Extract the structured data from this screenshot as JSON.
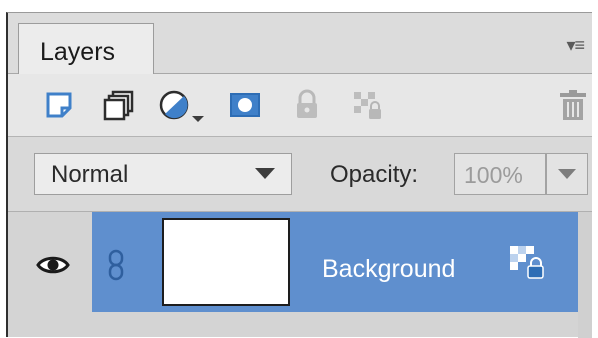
{
  "panel": {
    "tab_label": "Layers",
    "menu_icon": "panel-menu-icon"
  },
  "toolbar": {
    "tools": [
      {
        "icon": "new-layer-icon"
      },
      {
        "icon": "layer-group-icon"
      },
      {
        "icon": "adjustment-layer-icon"
      },
      {
        "icon": "layer-mask-icon"
      },
      {
        "icon": "lock-icon"
      },
      {
        "icon": "lock-transparency-icon"
      },
      {
        "icon": "trash-icon"
      }
    ]
  },
  "blend": {
    "mode": "Normal",
    "opacity_label": "Opacity:",
    "opacity_value": "100%"
  },
  "layers": [
    {
      "name": "Background",
      "visible": true,
      "selected": true,
      "locked": true
    }
  ],
  "colors": {
    "accent": "#5f8fce",
    "icon_blue": "#3f80c9"
  }
}
